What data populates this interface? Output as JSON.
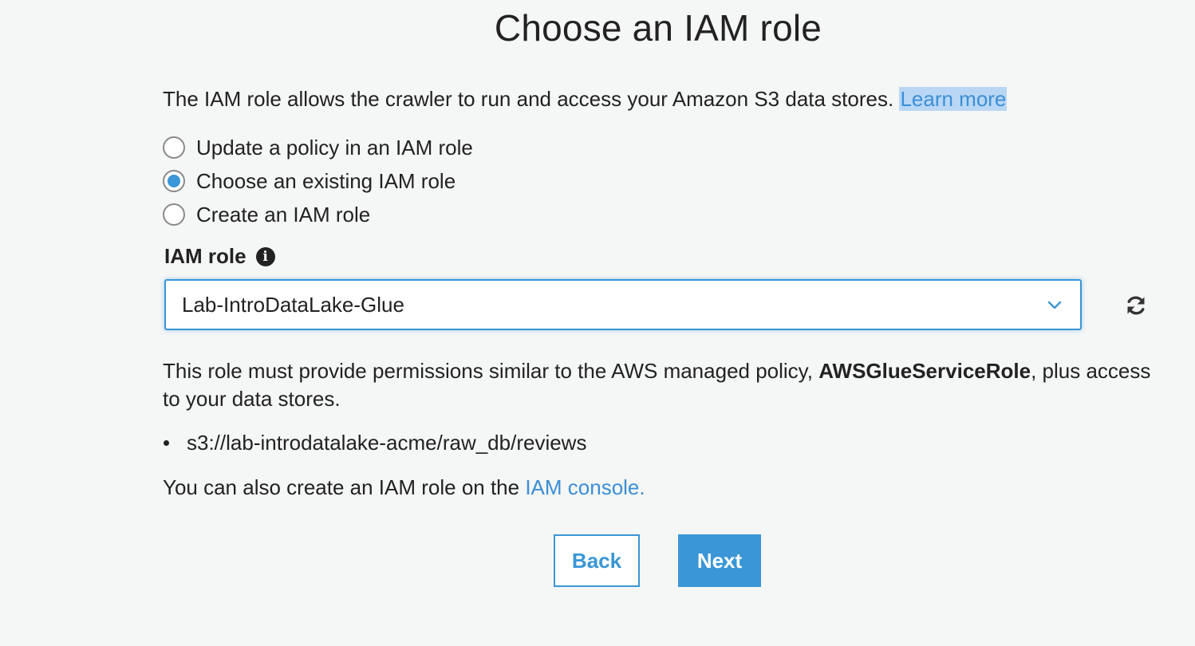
{
  "page": {
    "title": "Choose an IAM role"
  },
  "intro": {
    "text": "The IAM role allows the crawler to run and access your Amazon S3 data stores. ",
    "link_label": "Learn more"
  },
  "radio_options": [
    {
      "label": "Update a policy in an IAM role",
      "checked": false
    },
    {
      "label": "Choose an existing IAM role",
      "checked": true
    },
    {
      "label": "Create an IAM role",
      "checked": false
    }
  ],
  "iam_role": {
    "label": "IAM role",
    "info_icon": "info-icon",
    "selected_value": "Lab-IntroDataLake-Glue",
    "dropdown_icon": "chevron-down-icon",
    "refresh_icon": "refresh-icon"
  },
  "description": {
    "prefix": "This role must provide permissions similar to the AWS managed policy, ",
    "policy_name": "AWSGlueServiceRole",
    "suffix": ", plus access to your data stores."
  },
  "data_stores": [
    "s3://lab-introdatalake-acme/raw_db/reviews"
  ],
  "console_note": {
    "text": "You can also create an IAM role on the ",
    "link_label": "IAM console."
  },
  "buttons": {
    "back_label": "Back",
    "next_label": "Next"
  },
  "colors": {
    "accent": "#3a96d6",
    "link": "#3a8fd6",
    "link_highlight": "#b9d7f5",
    "background": "#f5f6f6"
  }
}
